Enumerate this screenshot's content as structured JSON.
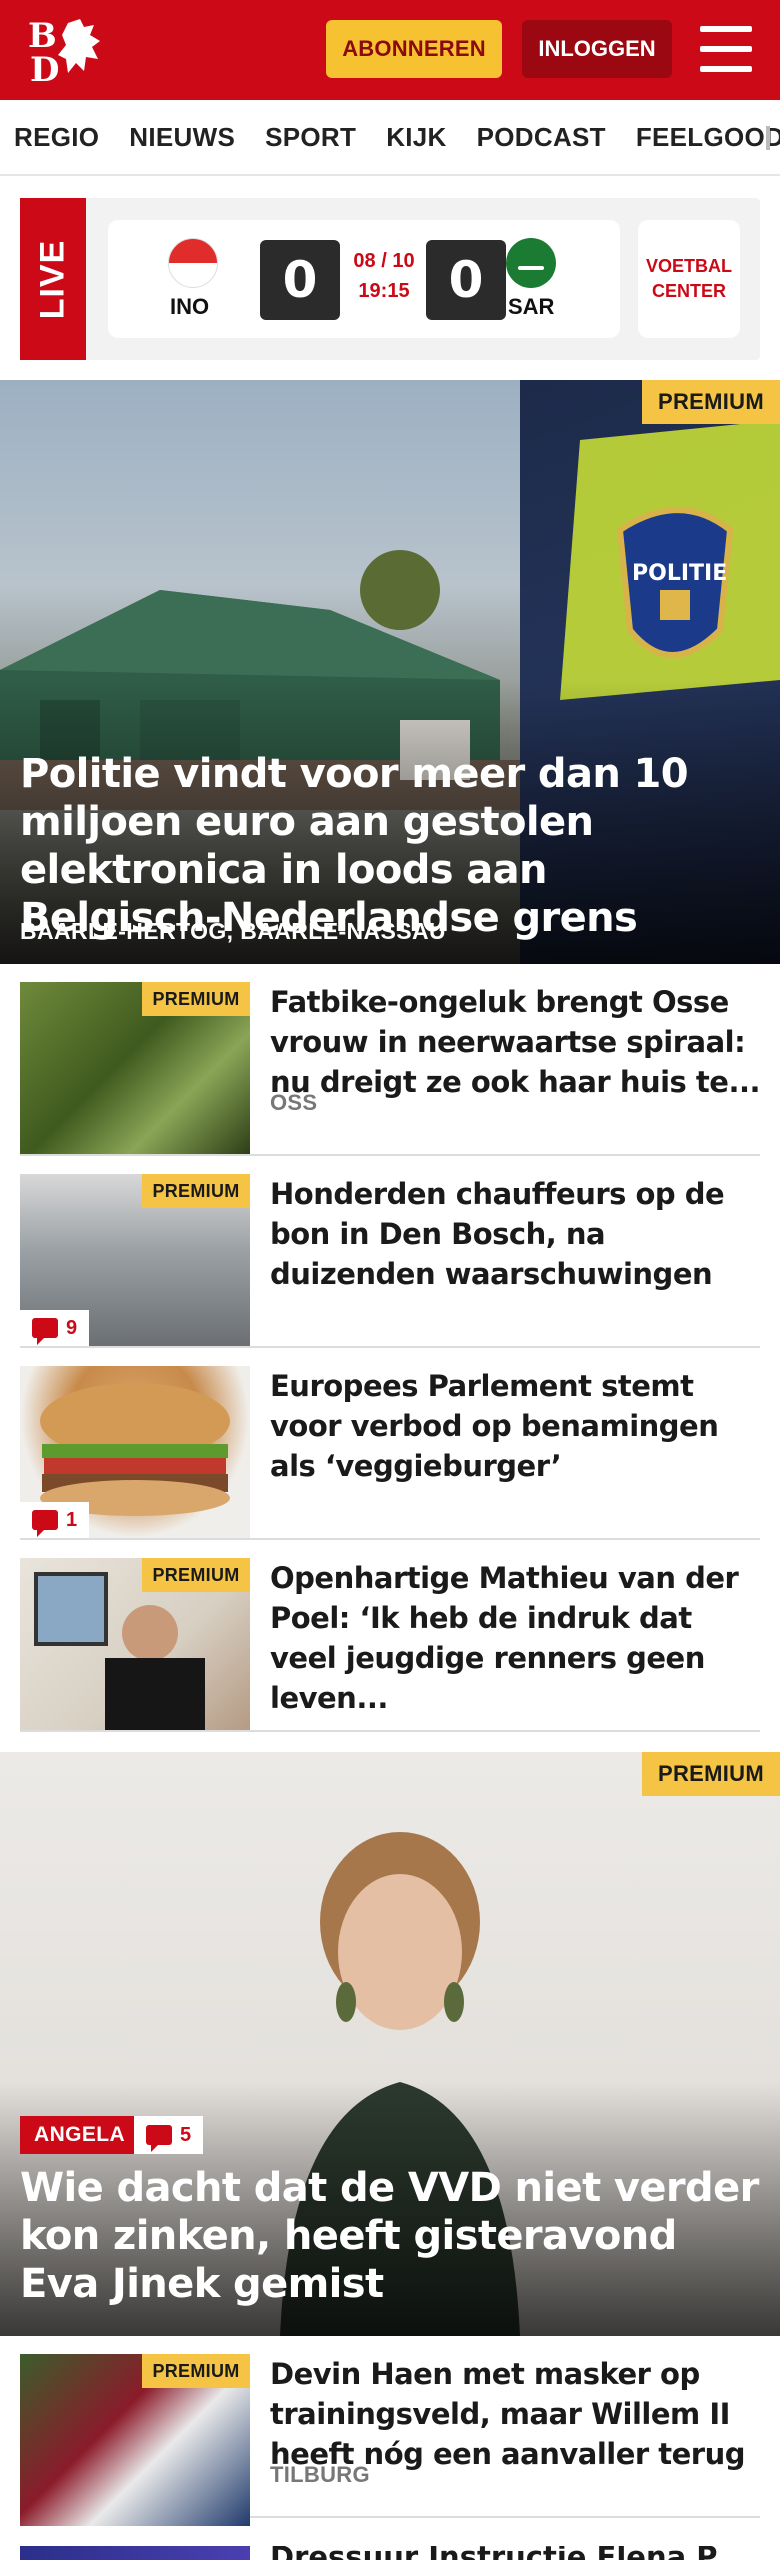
{
  "header": {
    "logo_text": "BD",
    "subscribe_label": "ABONNEREN",
    "login_label": "INLOGGEN",
    "colors": {
      "brand": "#cc0a17",
      "subscribe": "#f7c232",
      "login": "#9b0811"
    }
  },
  "nav": {
    "items": [
      "REGIO",
      "NIEUWS",
      "SPORT",
      "KIJK",
      "PODCAST",
      "FEELGOOD"
    ]
  },
  "live": {
    "tag": "LIVE",
    "home_team": "INO",
    "away_team": "SAR",
    "home_score": "0",
    "away_score": "0",
    "date": "08 / 10",
    "time": "19:15",
    "voetbal_center": "VOETBAL CENTER"
  },
  "hero": {
    "badge": "PREMIUM",
    "title": "Politie vindt voor meer dan 10 miljoen euro aan gestolen elektronica in loods aan Belgisch-Nederlandse grens",
    "location": "BAARLE-HERTOG, BAARLE-NASSAU"
  },
  "articles": [
    {
      "badge": "PREMIUM",
      "title": "Fatbike-ongeluk brengt Osse vrouw in neerwaartse spiraal: nu dreigt ze ook haar huis te...",
      "location": "OSS",
      "comments": ""
    },
    {
      "badge": "PREMIUM",
      "title": "Honderden chauffeurs op de bon in Den Bosch, na duizenden waarschuwingen",
      "location": "",
      "comments": "9"
    },
    {
      "badge": "",
      "title": "Europees Parlement stemt voor verbod op benamingen als ‘veggieburger’",
      "location": "",
      "comments": "1"
    },
    {
      "badge": "PREMIUM",
      "title": "Openhartige Mathieu van der Poel: ‘Ik heb de indruk dat veel jeugdige renners geen leven...",
      "location": "",
      "comments": ""
    }
  ],
  "opinion": {
    "badge": "PREMIUM",
    "tag": "ANGELA",
    "comments": "5",
    "title": "Wie dacht dat de VVD niet verder kon zinken, heeft gisteravond Eva Jinek gemist"
  },
  "article_after": {
    "badge": "PREMIUM",
    "title": "Devin Haen met masker op trainingsveld, maar Willem II heeft nóg een aanvaller terug",
    "location": "TILBURG"
  },
  "partial_next": {
    "title": "Dressuur Instructie Elena P..."
  }
}
